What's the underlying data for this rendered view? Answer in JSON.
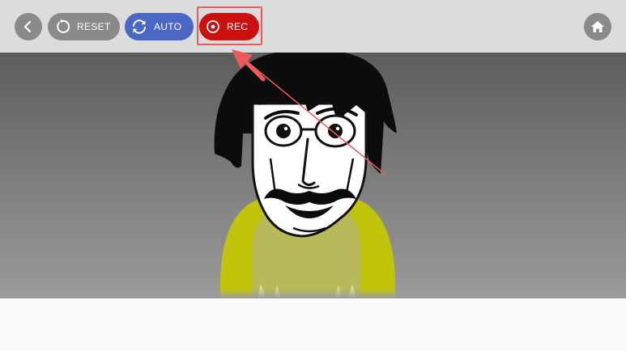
{
  "toolbar": {
    "back": {
      "icon": "chevron-left-icon"
    },
    "reset": {
      "label": "RESET",
      "icon": "reset-icon"
    },
    "auto": {
      "label": "AUTO",
      "icon": "sync-icon"
    },
    "rec": {
      "label": "REC",
      "icon": "record-icon"
    },
    "home": {
      "icon": "home-icon"
    }
  },
  "colors": {
    "toolbar_bg": "#dcdcdc",
    "gray_button": "#8a8a8a",
    "auto_button": "#4b67c4",
    "rec_button": "#cc0f0f",
    "annotation": "#ee5a5a",
    "shirt": "#c1c30a"
  },
  "stage": {
    "character": "beatboxer-character"
  },
  "annotation": {
    "type": "arrow-and-box",
    "target": "rec-button"
  }
}
